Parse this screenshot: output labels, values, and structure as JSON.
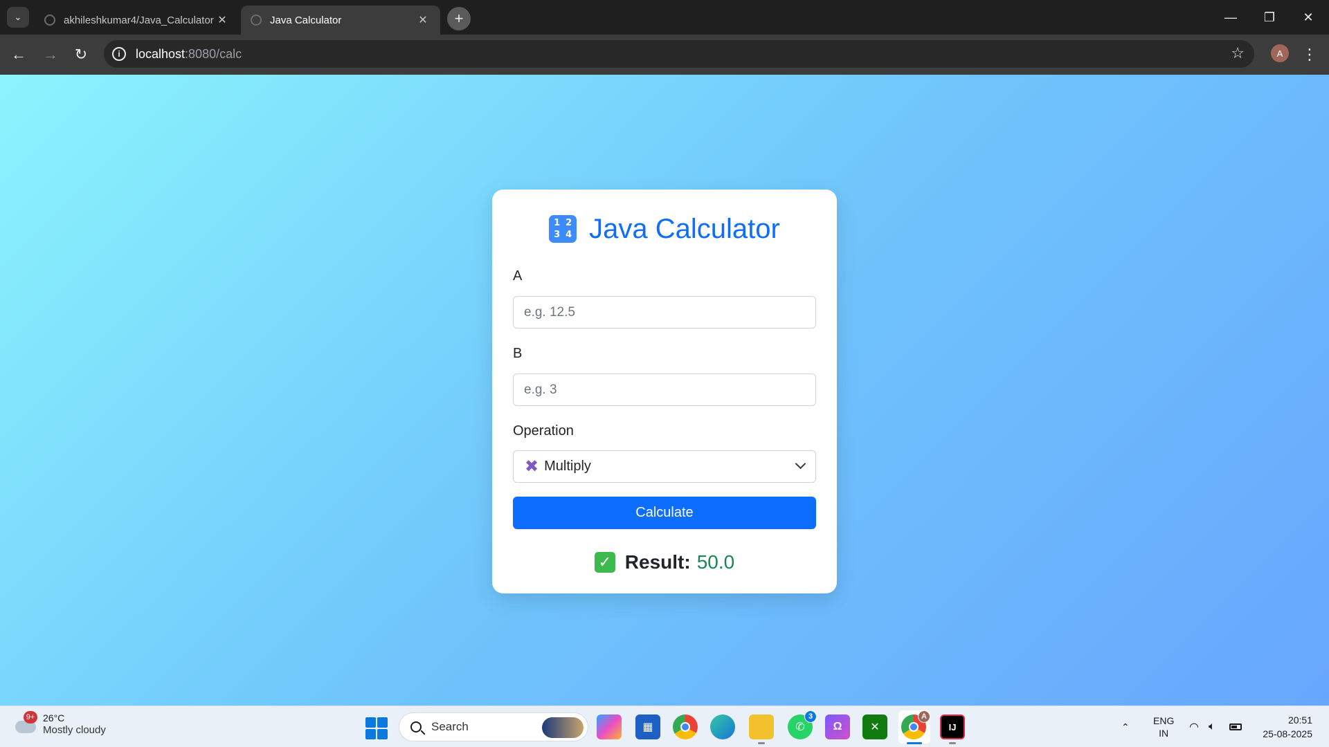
{
  "browser": {
    "tabs": [
      {
        "title": "akhileshkumar4/Java_Calculator",
        "active": false
      },
      {
        "title": "Java Calculator",
        "active": true
      }
    ],
    "url_host": "localhost",
    "url_rest": ":8080/calc",
    "profile_initial": "A"
  },
  "page": {
    "title": "Java Calculator",
    "title_icon_digits": [
      "1",
      "2",
      "3",
      "4"
    ],
    "field_a": {
      "label": "A",
      "placeholder": "e.g. 12.5",
      "value": ""
    },
    "field_b": {
      "label": "B",
      "placeholder": "e.g. 3",
      "value": ""
    },
    "operation": {
      "label": "Operation",
      "selected": "Multiply",
      "selected_icon": "✖"
    },
    "calculate_label": "Calculate",
    "result": {
      "label": "Result:",
      "value": "50.0"
    },
    "colors": {
      "accent": "#0d6efd",
      "result_value": "#198754",
      "bg_start": "#8cf4fd",
      "bg_end": "#67a6fd"
    }
  },
  "taskbar": {
    "weather": {
      "temp": "26°C",
      "condition": "Mostly cloudy",
      "badge": "9+"
    },
    "search_label": "Search",
    "whatsapp_badge": "3",
    "chrome_profile_badge": "A",
    "ide_label": "IJ",
    "language": {
      "line1": "ENG",
      "line2": "IN"
    },
    "time": "20:51",
    "date": "25-08-2025"
  }
}
